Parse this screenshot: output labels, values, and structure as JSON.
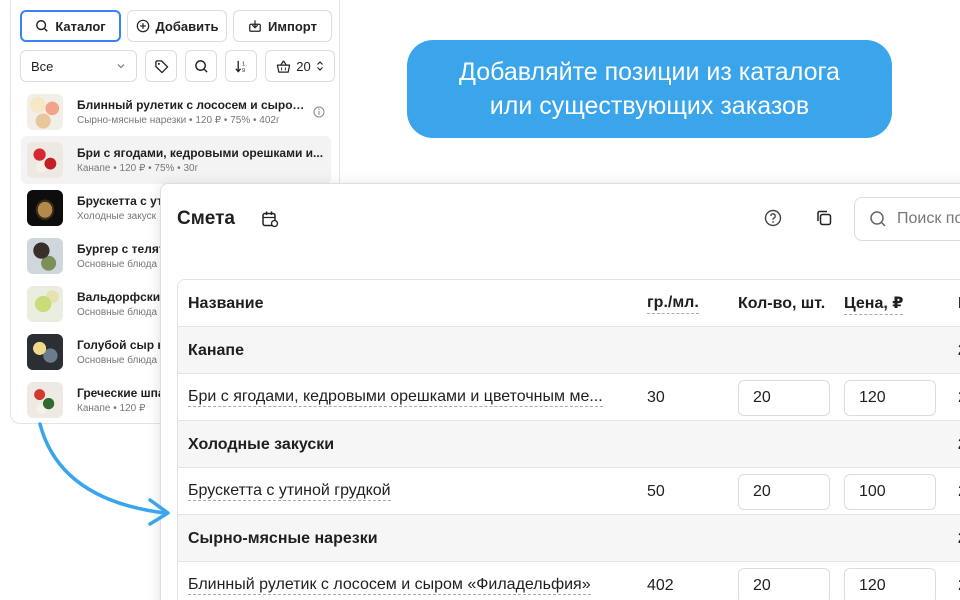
{
  "catalog": {
    "toolbar": {
      "catalog_label": "Каталог",
      "add_label": "Добавить",
      "import_label": "Импорт"
    },
    "filter": {
      "category_value": "Все",
      "count_value": "20"
    },
    "items": [
      {
        "name": "Блинный рулетик с лососем и сыром ...",
        "meta": "Сырно-мясные нарезки • 120 ₽ • 75% • 402г"
      },
      {
        "name": "Бри с ягодами, кедровыми орешками и...",
        "meta": "Канапе • 120 ₽ • 75% • 30г"
      },
      {
        "name": "Брускетта с ути",
        "meta": "Холодные закуск"
      },
      {
        "name": "Бургер с телят",
        "meta": "Основные блюда"
      },
      {
        "name": "Вальдорфский",
        "meta": "Основные блюда"
      },
      {
        "name": "Голубой сыр н",
        "meta": "Основные блюда"
      },
      {
        "name": "Греческие шпа",
        "meta": "Канапе • 120 ₽"
      }
    ]
  },
  "bubble": {
    "line1": "Добавляйте позиции из каталога",
    "line2": "или существующих заказов"
  },
  "estimate": {
    "title": "Смета",
    "search_placeholder": "Поиск по",
    "columns": {
      "name": "Название",
      "grams": "гр./мл.",
      "qty": "Кол-во, шт.",
      "price": "Цена, ₽",
      "extra": "I"
    },
    "rows": [
      {
        "type": "group",
        "name": "Канапе",
        "extra": "2"
      },
      {
        "type": "item",
        "name": "Бри с ягодами, кедровыми орешками и цветочным ме...",
        "grams": "30",
        "qty": "20",
        "price": "120",
        "extra": "2"
      },
      {
        "type": "group",
        "name": "Холодные закуски",
        "extra": "2"
      },
      {
        "type": "item",
        "name": "Брускетта с утиной грудкой",
        "grams": "50",
        "qty": "20",
        "price": "100",
        "extra": "2"
      },
      {
        "type": "group",
        "name": "Сырно-мясные нарезки",
        "extra": "2"
      },
      {
        "type": "item",
        "name": "Блинный рулетик с лососем и сыром «Филадельфия»",
        "grams": "402",
        "qty": "20",
        "price": "120",
        "extra": "2"
      }
    ]
  },
  "colors": {
    "accent": "#3b82f6",
    "bubble": "#3aa5eb",
    "arrow": "#3aa5eb"
  }
}
